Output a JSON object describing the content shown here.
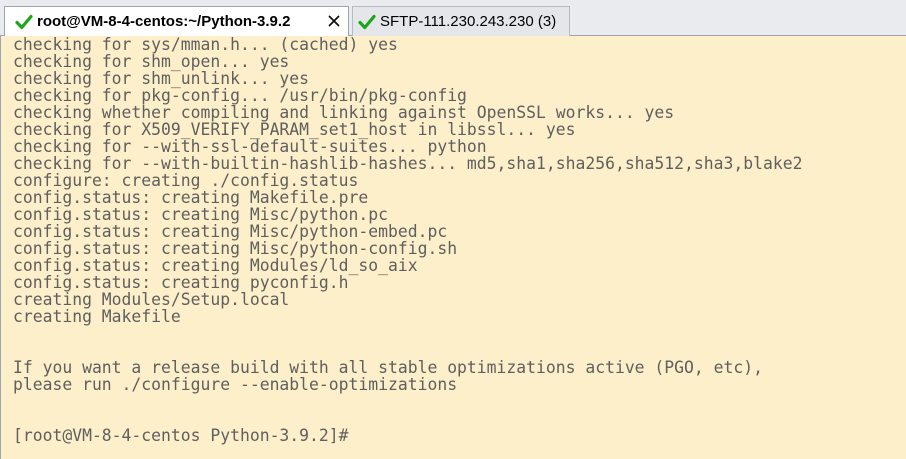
{
  "tabs": [
    {
      "label": "root@VM-8-4-centos:~/Python-3.9.2",
      "status_icon": "check-icon",
      "active": true
    },
    {
      "label": "SFTP-111.230.243.230 (3)",
      "status_icon": "check-icon",
      "active": false
    }
  ],
  "colors": {
    "terminal_background": "#fcefc9",
    "terminal_text": "#5f5f5f",
    "check_icon": "#1ea51e",
    "tab_active_background": "#ffffff"
  },
  "terminal": {
    "lines": [
      "checking for sys/mman.h... (cached) yes",
      "checking for shm_open... yes",
      "checking for shm_unlink... yes",
      "checking for pkg-config... /usr/bin/pkg-config",
      "checking whether compiling and linking against OpenSSL works... yes",
      "checking for X509_VERIFY_PARAM_set1_host in libssl... yes",
      "checking for --with-ssl-default-suites... python",
      "checking for --with-builtin-hashlib-hashes... md5,sha1,sha256,sha512,sha3,blake2",
      "configure: creating ./config.status",
      "config.status: creating Makefile.pre",
      "config.status: creating Misc/python.pc",
      "config.status: creating Misc/python-embed.pc",
      "config.status: creating Misc/python-config.sh",
      "config.status: creating Modules/ld_so_aix",
      "config.status: creating pyconfig.h",
      "creating Modules/Setup.local",
      "creating Makefile",
      "",
      "",
      "If you want a release build with all stable optimizations active (PGO, etc),",
      "please run ./configure --enable-optimizations",
      "",
      "",
      "[root@VM-8-4-centos Python-3.9.2]#"
    ]
  }
}
